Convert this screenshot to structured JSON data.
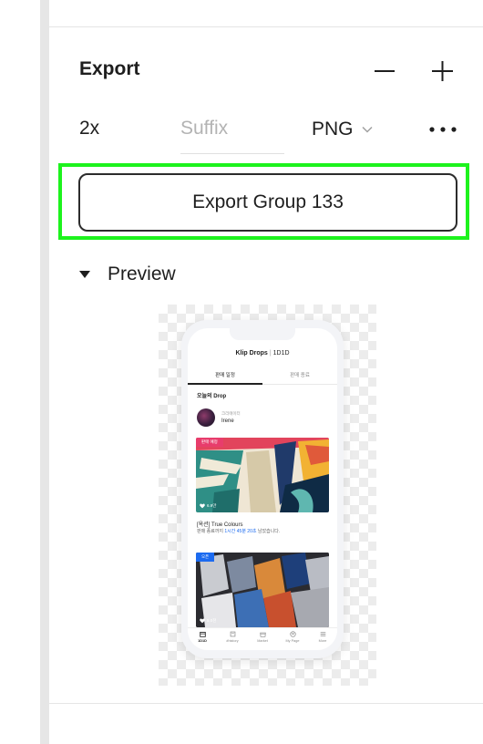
{
  "export_panel": {
    "title": "Export",
    "scale": "2x",
    "suffix_placeholder": "Suffix",
    "format": "PNG",
    "export_button_label": "Export Group 133",
    "preview_label": "Preview"
  },
  "preview": {
    "app_brand": "Klip Drops",
    "app_brand_sub": "1D1D",
    "tabs": [
      "판매 일정",
      "판매 종료"
    ],
    "section_title": "오늘의 Drop",
    "creator_role": "크리에이터",
    "creator_name": "Irene",
    "card1": {
      "badge": "판매 예정",
      "likes": "6.9만"
    },
    "item": {
      "title": "[옥션] True Colours",
      "desc_prefix": "판매 종료까지 ",
      "desc_time": "1시간 45분 20초",
      "desc_suffix": " 남았습니다."
    },
    "card2": {
      "badge": "오픈",
      "likes": "5.0천"
    },
    "nav": [
      "1D1D",
      "#history",
      "Market",
      "My Page",
      "More"
    ]
  },
  "colors": {
    "highlight": "#1df31d",
    "accent_blue": "#1c6bf0",
    "badge_pink": "#e83c6c"
  }
}
